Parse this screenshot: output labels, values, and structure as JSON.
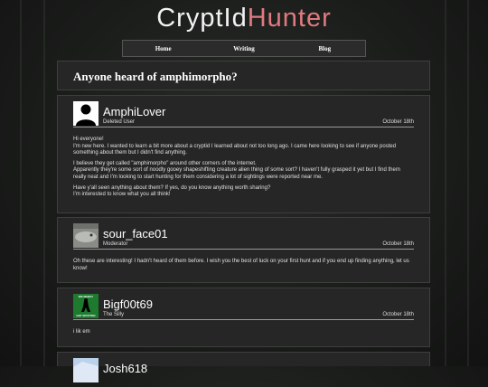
{
  "site": {
    "logo_part1": "CryptId",
    "logo_part2": "Hunter"
  },
  "nav": {
    "items": [
      "Home",
      "Writing",
      "Blog"
    ]
  },
  "thread": {
    "title": "Anyone heard of amphimorpho?"
  },
  "posts": [
    {
      "user": "AmphiLover",
      "role": "Deleted User",
      "date": "October 18th",
      "avatar": "default-user-icon",
      "paragraphs": [
        "Hi everyone!",
        "I'm new here. I wanted to learn a bit more about a cryptid I learned about not too long ago. I came here looking to see if anyone posted something about them but I didn't find anything.",
        "I believe they get called \"amphimorpho\" around other corners of the internet.",
        "Apparently they're some sort of noodly gooey shapeshifting creature alien thing of some sort? I haven't fully grasped it yet but I find them really neat and I'm looking to start hunting for them considering a lot of sightings were reported near me.",
        "Have y'all seen anything about them? If yes, do you know anything worth sharing?",
        "I'm interested to know what you all think!"
      ]
    },
    {
      "user": "sour_face01",
      "role": "Moderator",
      "date": "October 18th",
      "avatar": "grey-creature-photo",
      "paragraphs": [
        "Oh these are interesting! I hadn't heard of them before. I wish you the best of luck on your first hunt and if you end up finding anything, let us know!"
      ]
    },
    {
      "user": "Bigf00t69",
      "role": "The Silly",
      "date": "October 18th",
      "avatar": "green-bigfoot-sign",
      "avatar_text_top": "WE WHEN I",
      "avatar_text_bottom": "GET SPOTTED",
      "paragraphs": [
        "i lik em"
      ]
    },
    {
      "user": "Josh618",
      "role": "",
      "date": "",
      "avatar": "blue-sky-photo",
      "paragraphs": []
    }
  ]
}
